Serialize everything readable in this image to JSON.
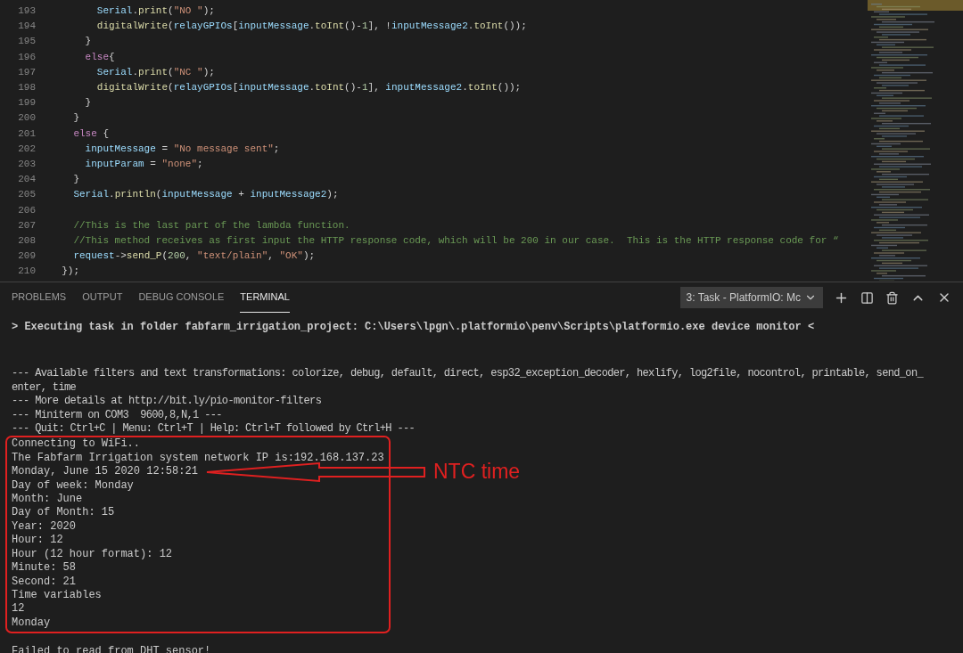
{
  "editor": {
    "lines": [
      {
        "number": "193",
        "tokens": [
          {
            "kind": "variable",
            "text": "        Serial"
          },
          {
            "kind": "plain",
            "text": "."
          },
          {
            "kind": "function",
            "text": "print"
          },
          {
            "kind": "plain",
            "text": "("
          },
          {
            "kind": "string",
            "text": "\"NO \""
          },
          {
            "kind": "plain",
            "text": ");"
          }
        ]
      },
      {
        "number": "194",
        "tokens": [
          {
            "kind": "function",
            "text": "        digitalWrite"
          },
          {
            "kind": "plain",
            "text": "("
          },
          {
            "kind": "variable",
            "text": "relayGPIOs"
          },
          {
            "kind": "plain",
            "text": "["
          },
          {
            "kind": "variable",
            "text": "inputMessage"
          },
          {
            "kind": "plain",
            "text": "."
          },
          {
            "kind": "function",
            "text": "toInt"
          },
          {
            "kind": "plain",
            "text": "()-"
          },
          {
            "kind": "number",
            "text": "1"
          },
          {
            "kind": "plain",
            "text": "], !"
          },
          {
            "kind": "variable",
            "text": "inputMessage2"
          },
          {
            "kind": "plain",
            "text": "."
          },
          {
            "kind": "function",
            "text": "toInt"
          },
          {
            "kind": "plain",
            "text": "());"
          }
        ]
      },
      {
        "number": "195",
        "tokens": [
          {
            "kind": "plain",
            "text": "      }"
          }
        ]
      },
      {
        "number": "196",
        "tokens": [
          {
            "kind": "keyword",
            "text": "      else"
          },
          {
            "kind": "plain",
            "text": "{"
          }
        ]
      },
      {
        "number": "197",
        "tokens": [
          {
            "kind": "variable",
            "text": "        Serial"
          },
          {
            "kind": "plain",
            "text": "."
          },
          {
            "kind": "function",
            "text": "print"
          },
          {
            "kind": "plain",
            "text": "("
          },
          {
            "kind": "string",
            "text": "\"NC \""
          },
          {
            "kind": "plain",
            "text": ");"
          }
        ]
      },
      {
        "number": "198",
        "tokens": [
          {
            "kind": "function",
            "text": "        digitalWrite"
          },
          {
            "kind": "plain",
            "text": "("
          },
          {
            "kind": "variable",
            "text": "relayGPIOs"
          },
          {
            "kind": "plain",
            "text": "["
          },
          {
            "kind": "variable",
            "text": "inputMessage"
          },
          {
            "kind": "plain",
            "text": "."
          },
          {
            "kind": "function",
            "text": "toInt"
          },
          {
            "kind": "plain",
            "text": "()-"
          },
          {
            "kind": "number",
            "text": "1"
          },
          {
            "kind": "plain",
            "text": "], "
          },
          {
            "kind": "variable",
            "text": "inputMessage2"
          },
          {
            "kind": "plain",
            "text": "."
          },
          {
            "kind": "function",
            "text": "toInt"
          },
          {
            "kind": "plain",
            "text": "());"
          }
        ]
      },
      {
        "number": "199",
        "tokens": [
          {
            "kind": "plain",
            "text": "      }"
          }
        ]
      },
      {
        "number": "200",
        "tokens": [
          {
            "kind": "plain",
            "text": "    }"
          }
        ]
      },
      {
        "number": "201",
        "tokens": [
          {
            "kind": "keyword",
            "text": "    else"
          },
          {
            "kind": "plain",
            "text": " {"
          }
        ]
      },
      {
        "number": "202",
        "tokens": [
          {
            "kind": "variable",
            "text": "      inputMessage"
          },
          {
            "kind": "plain",
            "text": " = "
          },
          {
            "kind": "string",
            "text": "\"No message sent\""
          },
          {
            "kind": "plain",
            "text": ";"
          }
        ]
      },
      {
        "number": "203",
        "tokens": [
          {
            "kind": "variable",
            "text": "      inputParam"
          },
          {
            "kind": "plain",
            "text": " = "
          },
          {
            "kind": "string",
            "text": "\"none\""
          },
          {
            "kind": "plain",
            "text": ";"
          }
        ]
      },
      {
        "number": "204",
        "tokens": [
          {
            "kind": "plain",
            "text": "    }"
          }
        ]
      },
      {
        "number": "205",
        "tokens": [
          {
            "kind": "variable",
            "text": "    Serial"
          },
          {
            "kind": "plain",
            "text": "."
          },
          {
            "kind": "function",
            "text": "println"
          },
          {
            "kind": "plain",
            "text": "("
          },
          {
            "kind": "variable",
            "text": "inputMessage"
          },
          {
            "kind": "plain",
            "text": " + "
          },
          {
            "kind": "variable",
            "text": "inputMessage2"
          },
          {
            "kind": "plain",
            "text": ");"
          }
        ]
      },
      {
        "number": "206"
      },
      {
        "number": "207",
        "tokens": [
          {
            "kind": "comment",
            "text": "    //This is the last part of the lambda function."
          }
        ]
      },
      {
        "number": "208",
        "tokens": [
          {
            "kind": "comment",
            "text": "    //This method receives as first input the HTTP response code, which will be 200 in our case.  This is the HTTP response code for “"
          }
        ]
      },
      {
        "number": "209",
        "tokens": [
          {
            "kind": "variable",
            "text": "    request"
          },
          {
            "kind": "plain",
            "text": "->"
          },
          {
            "kind": "function",
            "text": "send_P"
          },
          {
            "kind": "plain",
            "text": "("
          },
          {
            "kind": "number",
            "text": "200"
          },
          {
            "kind": "plain",
            "text": ", "
          },
          {
            "kind": "string",
            "text": "\"text/plain\""
          },
          {
            "kind": "plain",
            "text": ", "
          },
          {
            "kind": "string",
            "text": "\"OK\""
          },
          {
            "kind": "plain",
            "text": ");"
          }
        ]
      },
      {
        "number": "210",
        "tokens": [
          {
            "kind": "plain",
            "text": "  });"
          }
        ]
      }
    ]
  },
  "panel": {
    "tabs": [
      {
        "label": "PROBLEMS",
        "selected": false
      },
      {
        "label": "OUTPUT",
        "selected": false
      },
      {
        "label": "DEBUG CONSOLE",
        "selected": false
      },
      {
        "label": "TERMINAL",
        "selected": true
      }
    ],
    "terminal_select": "3: Task - PlatformIO: Mc"
  },
  "terminal": {
    "command": "> Executing task in folder fabfarm_irrigation_project: C:\\Users\\lpgn\\.platformio\\penv\\Scripts\\platformio.exe device monitor <",
    "header_lines": [
      "--- Available filters and text transformations: colorize, debug, default, direct, esp32_exception_decoder, hexlify, log2file, nocontrol, printable, send_on_",
      "enter, time",
      "--- More details at http://bit.ly/pio-monitor-filters",
      "--- Miniterm on COM3  9600,8,N,1 ---",
      "--- Quit: Ctrl+C | Menu: Ctrl+T | Help: Ctrl+T followed by Ctrl+H ---"
    ],
    "highlighted_lines": [
      "Connecting to WiFi..",
      "The Fabfarm Irrigation system network IP is:192.168.137.23",
      "Monday, June 15 2020 12:58:21",
      "Day of week: Monday",
      "Month: June",
      "Day of Month: 15",
      "Year: 2020",
      "Hour: 12",
      "Hour (12 hour format): 12",
      "Minute: 58",
      "Second: 21",
      "Time variables",
      "12",
      "Monday"
    ],
    "annotation": "NTC time",
    "after_lines": [
      "Failed to read from DHT sensor!"
    ]
  }
}
